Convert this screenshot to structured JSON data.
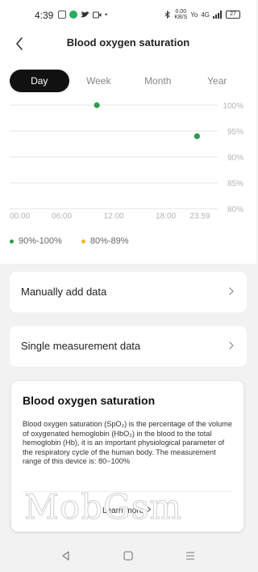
{
  "status_bar": {
    "time": "4:39",
    "net_speed_value": "0.00",
    "net_speed_unit": "KB/S",
    "signal_labels": [
      "Yo",
      "4G"
    ],
    "battery": "27"
  },
  "header": {
    "title": "Blood oxygen saturation"
  },
  "tabs": [
    {
      "label": "Day",
      "active": true
    },
    {
      "label": "Week",
      "active": false
    },
    {
      "label": "Month",
      "active": false
    },
    {
      "label": "Year",
      "active": false
    }
  ],
  "chart_data": {
    "type": "scatter",
    "x_tick_labels": [
      "00:00",
      "06:00",
      "12:00",
      "18:00",
      "23:59"
    ],
    "y_tick_labels": [
      "100%",
      "95%",
      "90%",
      "85%",
      "80%"
    ],
    "ylim": [
      80,
      100
    ],
    "xlim_minutes": [
      0,
      1439
    ],
    "points": [
      {
        "time": "10:03",
        "minutes": 603,
        "value": 100,
        "color": "#2e9e4f"
      },
      {
        "time": "21:36",
        "minutes": 1296,
        "value": 94,
        "color": "#2e9e4f"
      }
    ],
    "legend": [
      {
        "label": "90%-100%",
        "color": "#2e9e4f"
      },
      {
        "label": "80%-89%",
        "color": "#f2b824"
      }
    ]
  },
  "rows": {
    "manual": {
      "label": "Manually add data"
    },
    "single": {
      "label": "Single measurement data"
    }
  },
  "info": {
    "title": "Blood oxygen saturation",
    "body": "Blood oxygen saturation (SpO₂) is the percentage of the volume of oxygenated hemoglobin (HbO₂) in the blood to the total hemoglobin (Hb), it is an important physiological parameter of the respiratory cycle of the human body. The measurement range of this device is: 80~100%",
    "learn_more": "Learn more"
  },
  "watermark": "MobGsm",
  "icons": {
    "back": "chevron-left-icon",
    "row_chevron": "chevron-right-icon",
    "learn_more_chevron": "chevron-right-icon",
    "nav_back": "triangle-back-icon",
    "nav_home": "square-home-icon",
    "nav_menu": "menu-icon"
  }
}
